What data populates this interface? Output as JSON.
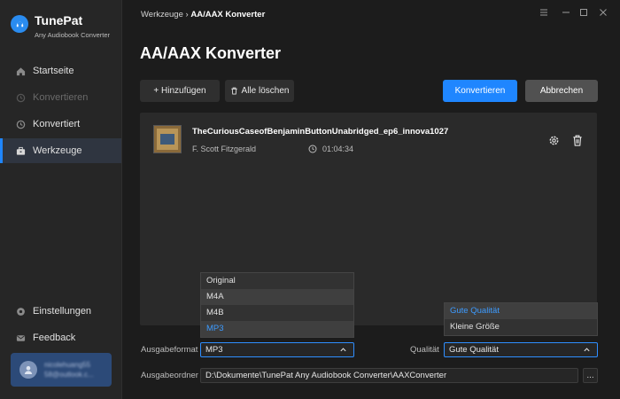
{
  "app": {
    "name": "TunePat",
    "subtitle": "Any Audiobook Converter"
  },
  "sidebar": {
    "items": [
      {
        "label": "Startseite",
        "icon": "home-icon",
        "state": "normal"
      },
      {
        "label": "Konvertieren",
        "icon": "convert-icon",
        "state": "disabled"
      },
      {
        "label": "Konvertiert",
        "icon": "clock-icon",
        "state": "normal"
      },
      {
        "label": "Werkzeuge",
        "icon": "toolbox-icon",
        "state": "active"
      }
    ],
    "bottom": [
      {
        "label": "Einstellungen",
        "icon": "gear-icon"
      },
      {
        "label": "Feedback",
        "icon": "mail-icon"
      }
    ],
    "user": {
      "line1": "nicolehuang55",
      "line2": "58@outlook.c..."
    }
  },
  "header": {
    "breadcrumb_parent": "Werkzeuge",
    "breadcrumb_sep": "›",
    "breadcrumb_current": "AA/AAX Konverter"
  },
  "page": {
    "title": "AA/AAX Konverter",
    "add_button": "+ Hinzufügen",
    "clear_button": "Alle löschen",
    "convert_button": "Konvertieren",
    "cancel_button": "Abbrechen"
  },
  "track": {
    "title": "TheCuriousCaseofBenjaminButtonUnabridged_ep6_innova1027",
    "author": "F. Scott Fitzgerald",
    "duration": "01:04:34"
  },
  "format_dropdown": {
    "options": [
      "Original",
      "M4A",
      "M4B",
      "MP3"
    ],
    "hovered": "M4A",
    "selected": "MP3"
  },
  "quality_dropdown": {
    "options": [
      "Gute Qualität",
      "Kleine Größe"
    ],
    "selected": "Gute Qualität"
  },
  "settings": {
    "format_label": "Ausgabeformat",
    "format_value": "MP3",
    "quality_label": "Qualität",
    "quality_value": "Gute Qualität",
    "folder_label": "Ausgabeordner",
    "folder_value": "D:\\Dokumente\\TunePat Any Audiobook Converter\\AAXConverter",
    "browse_label": "..."
  },
  "colors": {
    "accent": "#1f86ff",
    "sidebar_bg": "#262626",
    "main_bg": "#1c1c1c",
    "panel_bg": "#2a2a2a",
    "selected_text": "#3d9bff"
  }
}
